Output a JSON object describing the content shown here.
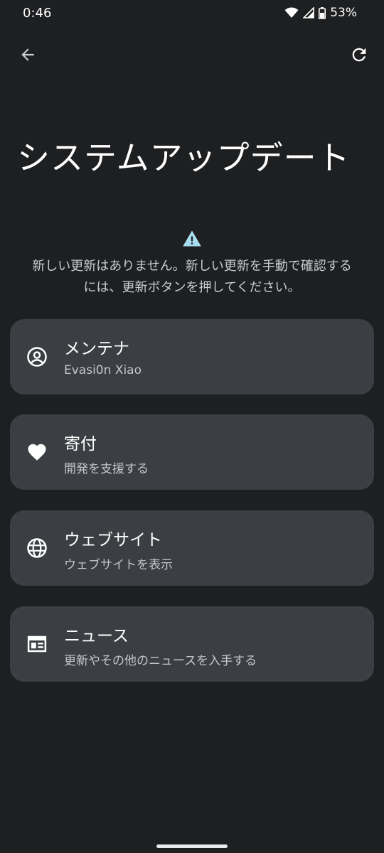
{
  "status_bar": {
    "time": "0:46",
    "battery": "53%"
  },
  "header": {
    "title": "システムアップデート"
  },
  "notice": {
    "text": "新しい更新はありません。新しい更新を手動で確認するには、更新ボタンを押してください。"
  },
  "cards": [
    {
      "icon": "account-circle-icon",
      "title": "メンテナ",
      "subtitle": "Evasi0n Xiao"
    },
    {
      "icon": "heart-icon",
      "title": "寄付",
      "subtitle": "開発を支援する"
    },
    {
      "icon": "globe-icon",
      "title": "ウェブサイト",
      "subtitle": "ウェブサイトを表示"
    },
    {
      "icon": "news-icon",
      "title": "ニュース",
      "subtitle": "更新やその他のニュースを入手する"
    }
  ],
  "colors": {
    "background": "#1e1f21",
    "card": "#3b3e42",
    "warning_accent": "#a8dcf0"
  }
}
